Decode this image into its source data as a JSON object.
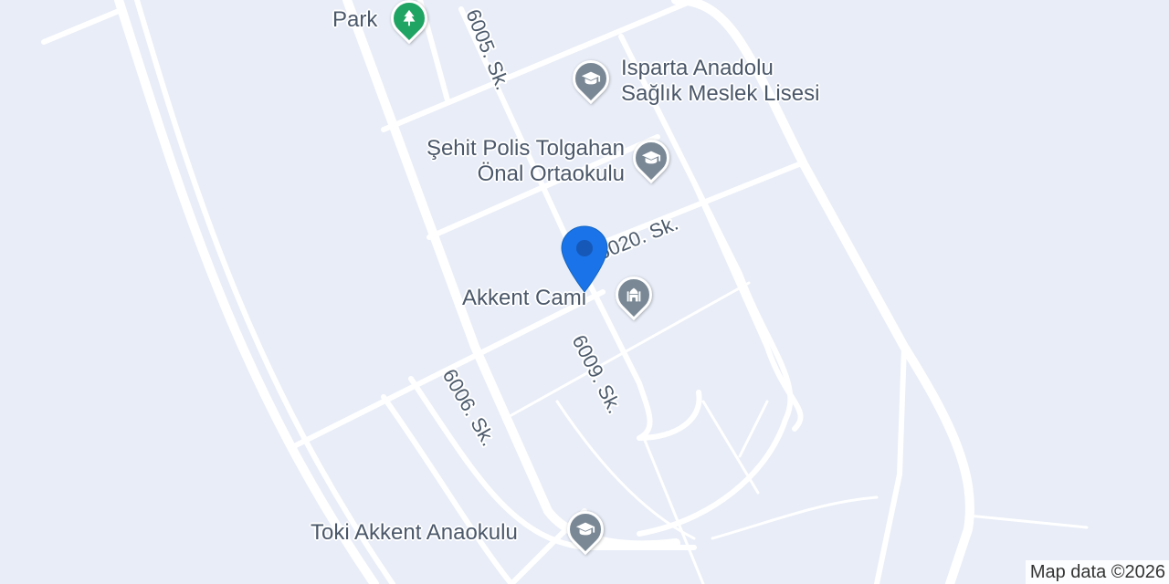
{
  "map": {
    "background_color": "#e8edf7",
    "road_color": "#ffffff",
    "street_label_color": "#4c5a6b"
  },
  "streets": {
    "s6005": "6005. Sk.",
    "s6020": "6020. Sk.",
    "s6009": "6009. Sk.",
    "s6006": "6006. Sk."
  },
  "pois": {
    "park": {
      "label": "Park",
      "icon": "tree-icon",
      "color": "#1fa463"
    },
    "isparta": {
      "line1": "Isparta Anadolu",
      "line2": "Sağlık Meslek Lisesi",
      "icon": "graduation-cap-icon",
      "color": "#7a8895"
    },
    "sehit": {
      "line1": "Şehit Polis Tolgahan",
      "line2": "Önal Ortaokulu",
      "icon": "graduation-cap-icon",
      "color": "#7a8895"
    },
    "akkent": {
      "label": "Akkent Cami",
      "icon": "mosque-icon",
      "color": "#7a8895"
    },
    "toki": {
      "label": "Toki Akkent Anaokulu",
      "icon": "graduation-cap-icon",
      "color": "#7a8895"
    }
  },
  "location_marker": {
    "icon": "map-pin-icon",
    "color": "#1a73e8"
  },
  "attribution": "Map data ©2026"
}
